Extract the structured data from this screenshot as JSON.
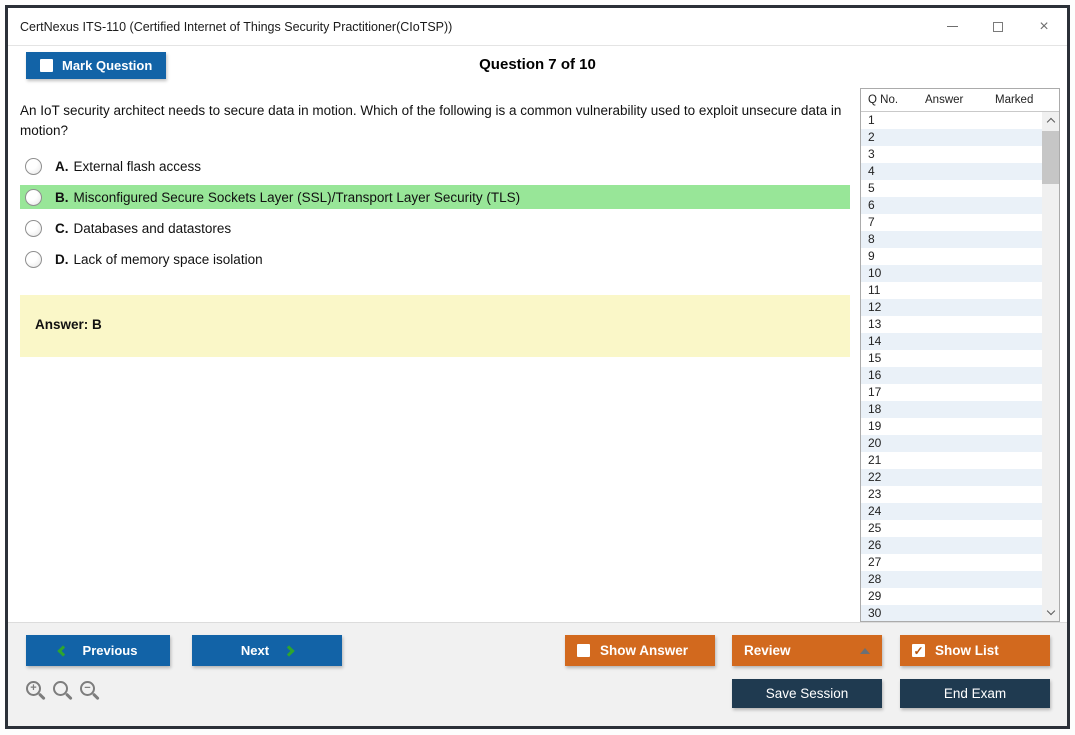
{
  "window": {
    "title": "CertNexus ITS-110 (Certified Internet of Things Security Practitioner(CIoTSP))",
    "controls": {
      "close": "×"
    }
  },
  "header": {
    "mark_question_label": "Mark Question",
    "mark_question_checked": false,
    "question_counter": "Question 7 of 10"
  },
  "question": {
    "text": "An IoT security architect needs to secure data in motion. Which of the following is a common vulnerability used to exploit unsecure data in motion?",
    "options": [
      {
        "letter": "A.",
        "text": "External flash access",
        "highlighted": false
      },
      {
        "letter": "B.",
        "text": "Misconfigured Secure Sockets Layer (SSL)/Transport Layer Security (TLS)",
        "highlighted": true
      },
      {
        "letter": "C.",
        "text": "Databases and datastores",
        "highlighted": false
      },
      {
        "letter": "D.",
        "text": "Lack of memory space isolation",
        "highlighted": false
      }
    ],
    "answer_label": "Answer: B"
  },
  "question_list": {
    "columns": [
      "Q No.",
      "Answer",
      "Marked"
    ],
    "visible_rows": [
      "1",
      "2",
      "3",
      "4",
      "5",
      "6",
      "7",
      "8",
      "9",
      "10",
      "11",
      "12",
      "13",
      "14",
      "15",
      "16",
      "17",
      "18",
      "19",
      "20",
      "21",
      "22",
      "23",
      "24",
      "25",
      "26",
      "27",
      "28",
      "29",
      "30"
    ]
  },
  "footer": {
    "previous_label": "Previous",
    "next_label": "Next",
    "show_answer_label": "Show Answer",
    "show_answer_checked": false,
    "review_label": "Review",
    "show_list_label": "Show List",
    "show_list_checked": true,
    "save_session_label": "Save Session",
    "end_exam_label": "End Exam"
  },
  "colors": {
    "accent-blue": "#1263a7",
    "accent-orange": "#d2691e",
    "accent-navy": "#1f3a50",
    "highlight-green": "#98e698",
    "answer-yellow": "#faf7c8",
    "alt-row-blue": "#eaf1f8",
    "chevron-green": "#2ea52e"
  }
}
